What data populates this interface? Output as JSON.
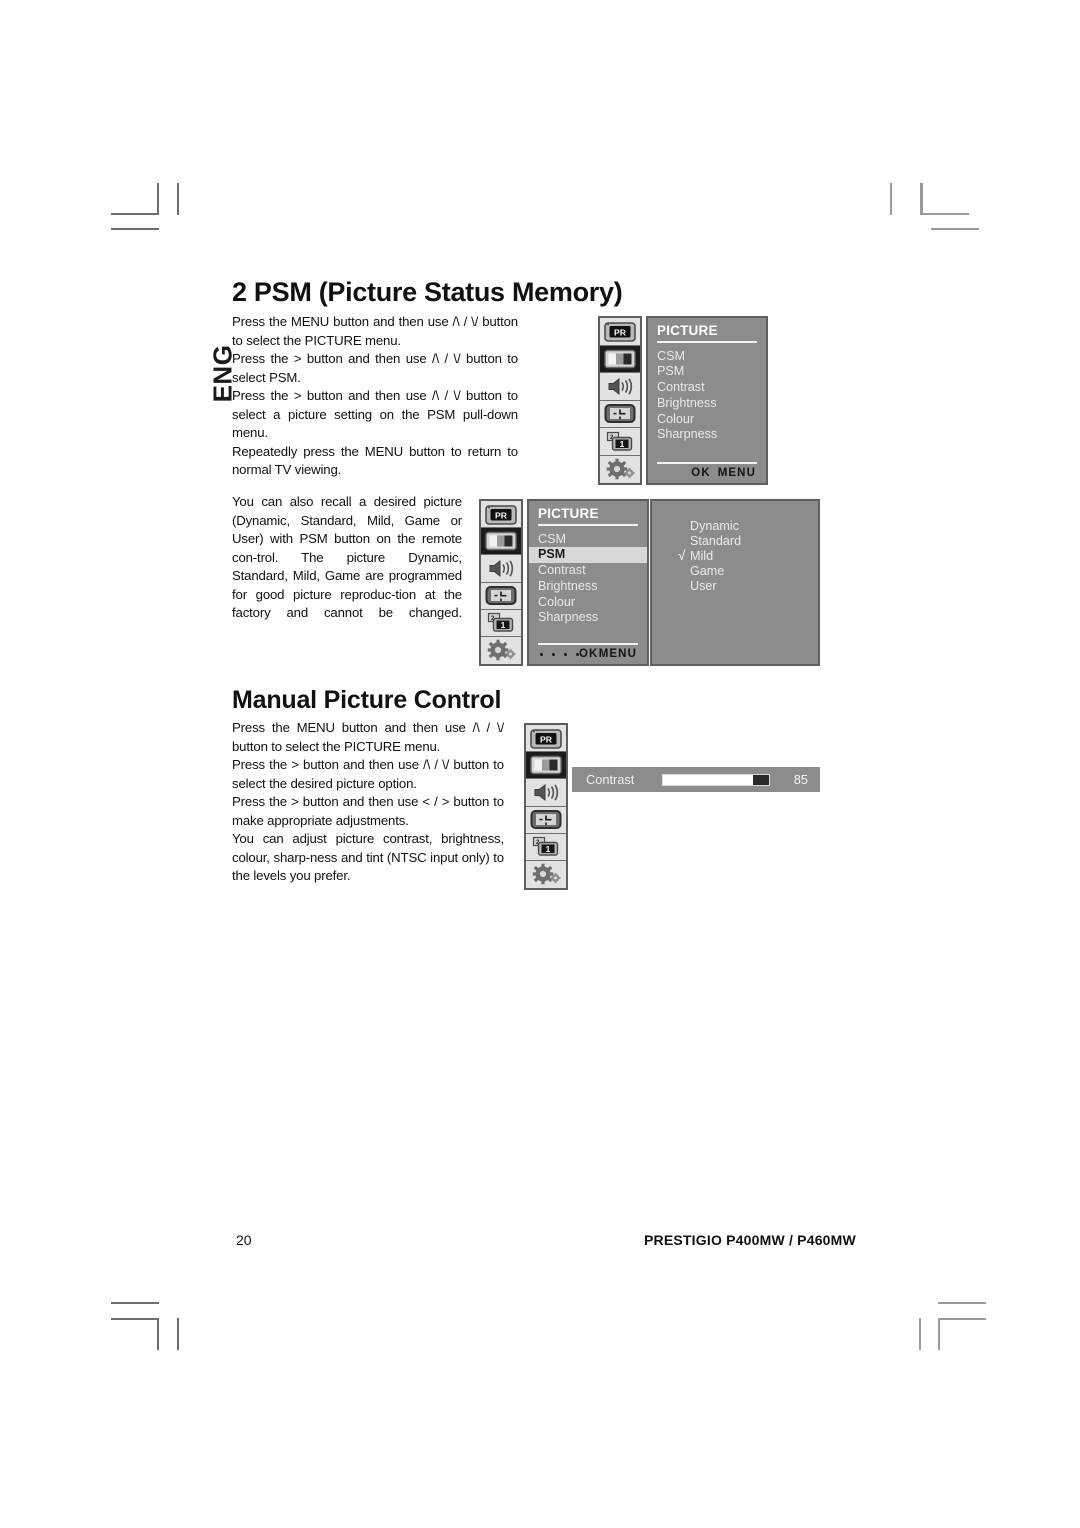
{
  "page": {
    "language_tab": "ENG",
    "folio": "20",
    "footer_model": "PRESTIGIO P400MW / P460MW"
  },
  "sections": [
    {
      "heading": "2 PSM (Picture Status Memory)",
      "paragraphs": [
        "Press the MENU button and then use /\\ / \\/ button to select the PICTURE menu.",
        "Press the > button and then use /\\ / \\/ button to select PSM.",
        "Press the > button and then use /\\ / \\/ button to select a picture setting on the PSM pull-down menu.",
        "Repeatedly press the MENU button to return to normal TV viewing.",
        "You can also recall a desired picture (Dynamic, Standard, Mild, Game or User) with PSM button on the remote con-trol. The picture Dynamic, Standard, Mild, Game are programmed for good picture reproduc-tion at the factory and cannot be changed."
      ]
    },
    {
      "heading": "Manual Picture Control",
      "paragraphs": [
        "Press the MENU button and then use /\\ / \\/ button to select the PICTURE menu.",
        "Press the > button and then use /\\ / \\/ button to select the desired picture option.",
        "Press the > button and then use < / > button to make appropriate adjustments.",
        "You can adjust picture contrast, brightness, colour, sharp-ness and tint (NTSC input only) to the levels you prefer."
      ]
    }
  ],
  "osd_rail": {
    "icons": [
      {
        "name": "pr-channel-icon",
        "label": "PR"
      },
      {
        "name": "picture-icon",
        "label": ""
      },
      {
        "name": "sound-speaker-icon",
        "label": ""
      },
      {
        "name": "time-clock-icon",
        "label": ""
      },
      {
        "name": "special-pip-icon",
        "label": "1"
      },
      {
        "name": "setup-gear-icon",
        "label": ""
      }
    ],
    "active_index": 1
  },
  "osd_picture_menu": {
    "title": "PICTURE",
    "items": [
      "CSM",
      "PSM",
      "Contrast",
      "Brightness",
      "Colour",
      "Sharpness"
    ],
    "selected_index": -1,
    "footer": {
      "ok": "OK",
      "menu": "MENU",
      "dots": 0
    }
  },
  "osd_psm_menu": {
    "title": "PICTURE",
    "items": [
      "CSM",
      "PSM",
      "Contrast",
      "Brightness",
      "Colour",
      "Sharpness"
    ],
    "selected_index": 1,
    "footer": {
      "ok": "OK",
      "menu": "MENU",
      "dots": 4
    },
    "submenu": {
      "options": [
        "Dynamic",
        "Standard",
        "Mild",
        "Game",
        "User"
      ],
      "checked_index": 2,
      "check_glyph": "√"
    }
  },
  "osd_contrast": {
    "label": "Contrast",
    "value": "85",
    "fill_percent": 85
  },
  "colors": {
    "osd_panel_bg": "#8c8c8c",
    "osd_panel_border": "#606060",
    "osd_rail_bg": "#e2e2e2",
    "osd_rail_active": "#1c1c1c",
    "osd_text": "#e9e9e9",
    "osd_selected_bg": "#d8d8d8",
    "slider_fill": "#ffffff",
    "page_text": "#111111",
    "cropmark": "#6d6d6d"
  }
}
